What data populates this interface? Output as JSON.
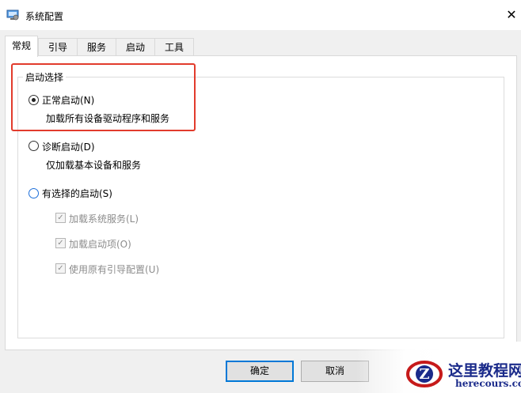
{
  "window": {
    "title": "系统配置",
    "close_icon": "close-icon"
  },
  "tabs": [
    {
      "label": "常规",
      "active": true
    },
    {
      "label": "引导",
      "active": false
    },
    {
      "label": "服务",
      "active": false
    },
    {
      "label": "启动",
      "active": false
    },
    {
      "label": "工具",
      "active": false
    }
  ],
  "startup": {
    "group_title": "启动选择",
    "normal": {
      "label": "正常启动(N)",
      "description": "加载所有设备驱动程序和服务",
      "selected": true
    },
    "diagnostic": {
      "label": "诊断启动(D)",
      "description": "仅加载基本设备和服务",
      "selected": false
    },
    "selective": {
      "label": "有选择的启动(S)",
      "selected": false,
      "options": [
        {
          "label": "加载系统服务(L)",
          "checked": true,
          "enabled": false
        },
        {
          "label": "加载启动项(O)",
          "checked": true,
          "enabled": false
        },
        {
          "label": "使用原有引导配置(U)",
          "checked": true,
          "enabled": false
        }
      ]
    }
  },
  "buttons": {
    "ok": "确定",
    "cancel": "取消"
  },
  "watermark": {
    "cn": "这里教程网",
    "en": "herecours.com"
  },
  "colors": {
    "highlight": "#e23b2c",
    "focus_blue": "#0078d7",
    "watermark": "#1a2a8a"
  }
}
